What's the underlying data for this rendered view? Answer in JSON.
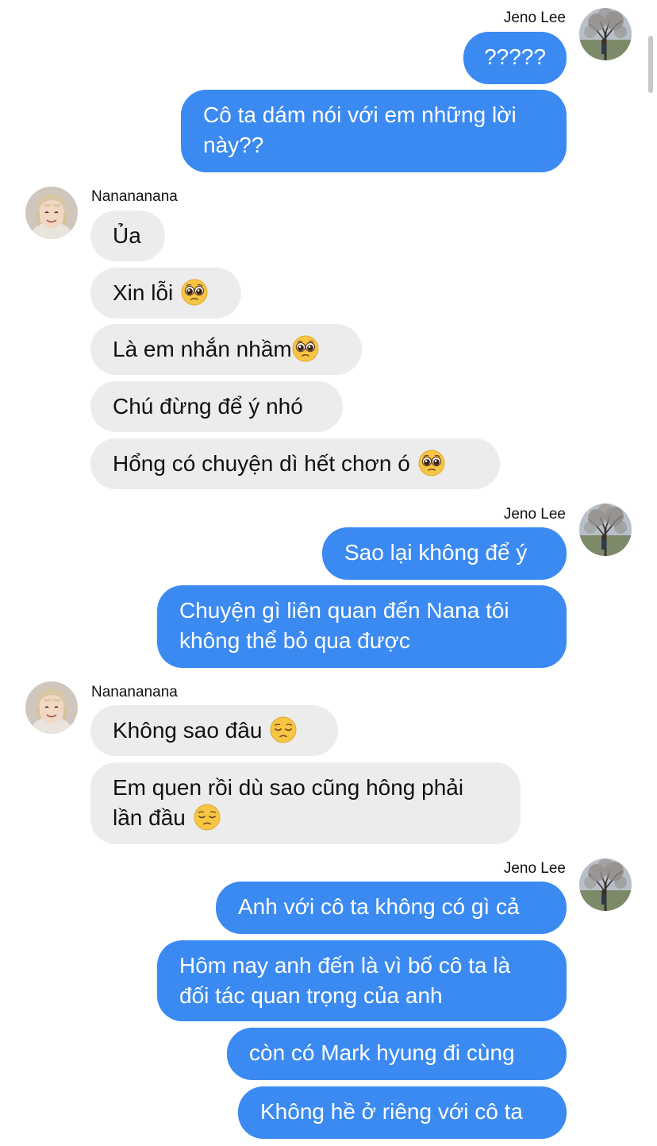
{
  "messages": [
    {
      "sender": "Jeno Lee",
      "text": "?????"
    },
    {
      "sender": "Jeno Lee",
      "text": "Cô ta dám nói với em những lời này??"
    },
    {
      "sender": "Nanananana",
      "text": "Ủa"
    },
    {
      "sender": "Nanananana",
      "text": "Xin lỗi"
    },
    {
      "sender": "Nanananana",
      "text": "Là em nhắn nhầm"
    },
    {
      "sender": "Nanananana",
      "text": "Chú đừng để ý nhó"
    },
    {
      "sender": "Nanananana",
      "text": "Hổng có chuyện dì hết chơn ó"
    },
    {
      "sender": "Jeno Lee",
      "text": "Sao lại không để ý"
    },
    {
      "sender": "Jeno Lee",
      "text": "Chuyện gì liên quan đến Nana tôi không thể bỏ qua được"
    },
    {
      "sender": "Nanananana",
      "text": "Không sao đâu"
    },
    {
      "sender": "Nanananana",
      "text": "Em quen rồi dù sao cũng hông phải lần đầu"
    },
    {
      "sender": "Jeno Lee",
      "text": "Anh với cô ta không có gì cả"
    },
    {
      "sender": "Jeno Lee",
      "text": "Hôm nay anh đến là vì bố cô ta là đối tác quan trọng của anh"
    },
    {
      "sender": "Jeno Lee",
      "text": "còn có Mark hyung đi cùng"
    },
    {
      "sender": "Jeno Lee",
      "text": "Không hề ở riêng với cô ta"
    }
  ],
  "icons": {
    "pleading": "pleading-face-emoji",
    "pensive": "pensive-face-emoji"
  },
  "colors": {
    "outgoing_bubble": "#3b8af2",
    "incoming_bubble": "#ececec",
    "outgoing_text": "#ffffff",
    "incoming_text": "#111111"
  }
}
